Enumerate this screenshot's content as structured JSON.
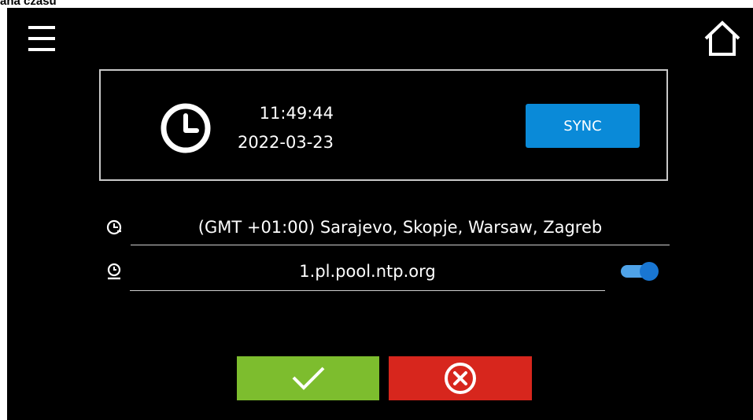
{
  "document": {
    "caption": "ana czasu"
  },
  "header": {
    "menu_icon": "hamburger-menu-icon",
    "home_icon": "home-icon"
  },
  "clock_panel": {
    "icon": "clock-icon",
    "time": "11:49:44",
    "date": "2022-03-23",
    "sync_label": "SYNC"
  },
  "settings": {
    "timezone": {
      "icon": "timezone-icon",
      "value": "(GMT +01:00) Sarajevo, Skopje, Warsaw, Zagreb"
    },
    "ntp_server": {
      "icon": "ntp-server-icon",
      "value": "1.pl.pool.ntp.org",
      "sync_enabled": true
    }
  },
  "actions": {
    "confirm_icon": "checkmark-icon",
    "cancel_icon": "cancel-x-icon"
  },
  "colors": {
    "screen_bg": "#000000",
    "sync_button": "#0a8ad8",
    "confirm_button": "#7dbd2e",
    "cancel_button": "#d7261d",
    "toggle_on": "#1976d2"
  }
}
